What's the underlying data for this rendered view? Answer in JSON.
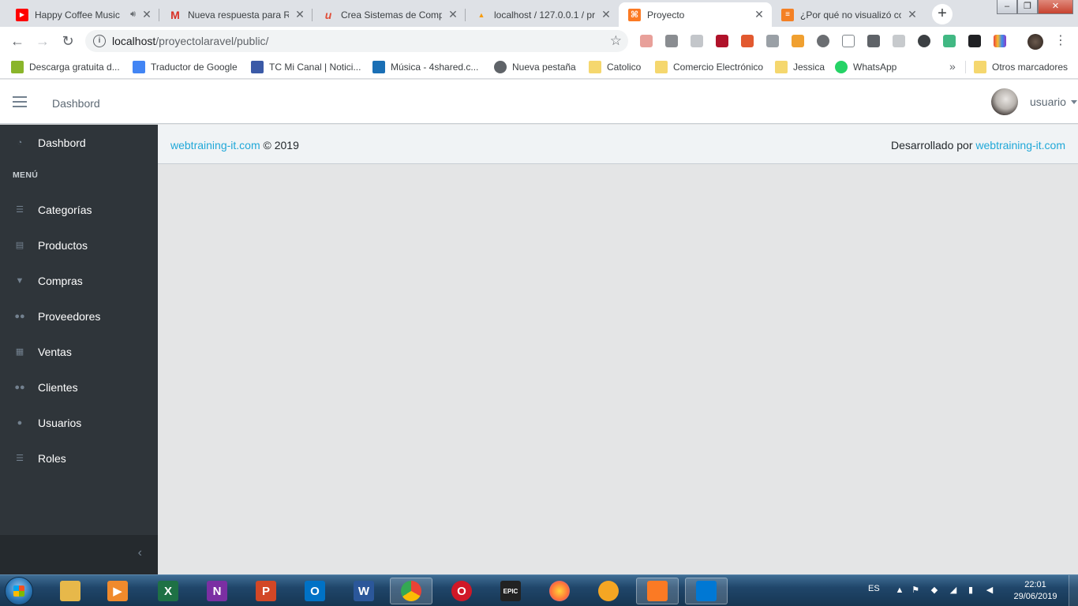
{
  "browser": {
    "tabs": [
      {
        "title": "Happy Coffee Music",
        "favicon_color": "#ff0000",
        "favicon_glyph": "play-icon",
        "audio": true
      },
      {
        "title": "Nueva respuesta para Re",
        "favicon_color": "#d93025",
        "favicon_glyph": "gmail-icon"
      },
      {
        "title": "Crea Sistemas de Compr",
        "favicon_color": "#e04e39",
        "favicon_glyph": "udemy-icon"
      },
      {
        "title": "localhost / 127.0.0.1 / pr",
        "favicon_color": "#f89c0e",
        "favicon_glyph": "phpmyadmin-icon"
      },
      {
        "title": "Proyecto",
        "favicon_color": "#fb7a24",
        "favicon_glyph": "xampp-icon",
        "active": true
      },
      {
        "title": "¿Por qué no visualizó co",
        "favicon_color": "#f48024",
        "favicon_glyph": "stackoverflow-icon"
      }
    ],
    "address": {
      "host": "localhost",
      "path": "/proyectolaravel/public/"
    },
    "bookmarks": [
      {
        "label": "Descarga gratuita d...",
        "icon": "download-arrow-icon",
        "color": "#8ab52a"
      },
      {
        "label": "Traductor de Google",
        "icon": "google-translate-icon",
        "color": "#4285f4"
      },
      {
        "label": "TC Mi Canal | Notici...",
        "icon": "tc-icon",
        "color": "#3b5aa7"
      },
      {
        "label": "Música - 4shared.c...",
        "icon": "4shared-icon",
        "color": "#1a6fb5"
      },
      {
        "label": "Nueva pestaña",
        "icon": "globe-icon",
        "color": "#5f6368"
      },
      {
        "label": "Catolico",
        "icon": "folder-icon",
        "color": "#f5d76e"
      },
      {
        "label": "Comercio Electrónico",
        "icon": "folder-icon",
        "color": "#f5d76e"
      },
      {
        "label": "Jessica",
        "icon": "folder-icon",
        "color": "#f5d76e"
      },
      {
        "label": "WhatsApp",
        "icon": "whatsapp-icon",
        "color": "#25d366"
      }
    ],
    "more": "»",
    "other_bookmarks": "Otros marcadores"
  },
  "app": {
    "breadcrumb": "Dashbord",
    "username": "usuario",
    "sidebar": {
      "dashboard": "Dashbord",
      "menu_title": "MENÚ",
      "items": [
        {
          "label": "Categorías",
          "icon": "list-icon"
        },
        {
          "label": "Productos",
          "icon": "stack-icon"
        },
        {
          "label": "Compras",
          "icon": "cart-icon"
        },
        {
          "label": "Proveedores",
          "icon": "users-icon"
        },
        {
          "label": "Ventas",
          "icon": "briefcase-icon"
        },
        {
          "label": "Clientes",
          "icon": "users-icon"
        },
        {
          "label": "Usuarios",
          "icon": "user-icon"
        },
        {
          "label": "Roles",
          "icon": "list-icon"
        }
      ],
      "minimizer": "‹"
    },
    "footer": {
      "left_link": "webtraining-it.com",
      "left_text": "© 2019",
      "right_text": "Desarrollado por",
      "right_link": "webtraining-it.com"
    },
    "colors": {
      "sidebar_bg": "#2f353a",
      "link": "#20a8d8",
      "main_bg": "#e4e5e6"
    }
  },
  "taskbar": {
    "apps": [
      {
        "name": "explorer-icon",
        "label": "",
        "color": "#e7b84a"
      },
      {
        "name": "media-player-icon",
        "label": "",
        "color": "#f08a2c"
      },
      {
        "name": "excel-icon",
        "label": "X",
        "color": "#1e7145"
      },
      {
        "name": "onenote-icon",
        "label": "N",
        "color": "#7b2fa3"
      },
      {
        "name": "powerpoint-icon",
        "label": "P",
        "color": "#d24726"
      },
      {
        "name": "outlook-icon",
        "label": "O",
        "color": "#0072c6"
      },
      {
        "name": "word-icon",
        "label": "W",
        "color": "#2b579a"
      },
      {
        "name": "chrome-icon",
        "label": "",
        "color": "#4285f4",
        "active": true
      },
      {
        "name": "opera-icon",
        "label": "O",
        "color": "#d01827"
      },
      {
        "name": "epic-games-icon",
        "label": "EPIC",
        "color": "#222222"
      },
      {
        "name": "firefox-icon",
        "label": "",
        "color": "#ff7139"
      },
      {
        "name": "vpn-icon",
        "label": "",
        "color": "#f5a623"
      },
      {
        "name": "xampp-icon",
        "label": "",
        "color": "#fb7a24",
        "active": true
      },
      {
        "name": "vscode-icon",
        "label": "",
        "color": "#0078d4",
        "active": true
      }
    ],
    "language": "ES",
    "time": "22:01",
    "date": "29/06/2019"
  }
}
